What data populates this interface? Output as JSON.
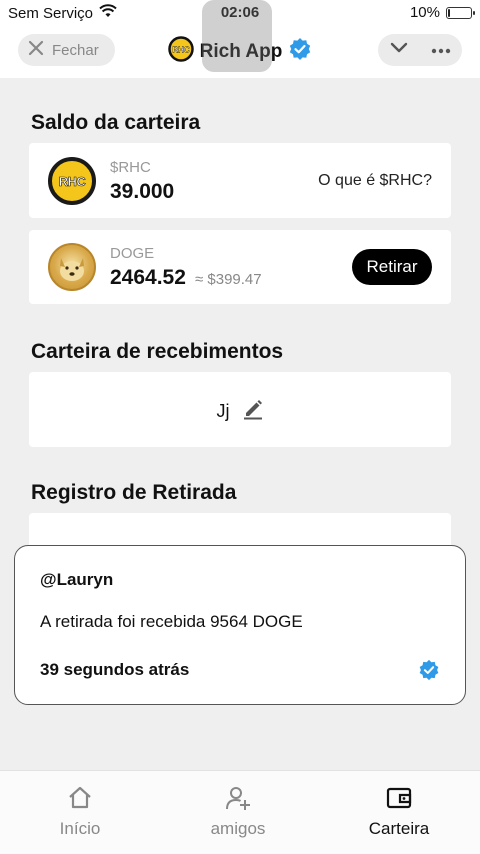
{
  "status": {
    "carrier": "Sem Serviço",
    "time": "02:06",
    "battery": "10%",
    "battery_level": 0.1
  },
  "nav": {
    "close_label": "Fechar",
    "title": "Rich App"
  },
  "wallet": {
    "section_title": "Saldo da carteira",
    "rhc": {
      "logo_text": "RHC",
      "symbol": "$RHC",
      "amount": "39.000",
      "info_link": "O que é $RHC?"
    },
    "doge": {
      "symbol": "DOGE",
      "amount": "2464.52",
      "approx": "≈ $399.47",
      "withdraw_label": "Retirar"
    }
  },
  "receiving": {
    "section_title": "Carteira de recebimentos",
    "value": "Jj"
  },
  "withdrawals": {
    "section_title": "Registro de Retirada"
  },
  "toast": {
    "user": "@Lauryn",
    "message": "A retirada foi recebida 9564 DOGE",
    "time_ago": "39 segundos atrás"
  },
  "tabs": [
    {
      "label": "Início",
      "icon": "home-icon"
    },
    {
      "label": "amigos",
      "icon": "add-friend-icon"
    },
    {
      "label": "Carteira",
      "icon": "wallet-icon"
    }
  ],
  "colors": {
    "verified_blue": "#2f9be8",
    "coin_yellow": "#f4c51a",
    "page_bg": "#efeff0"
  }
}
